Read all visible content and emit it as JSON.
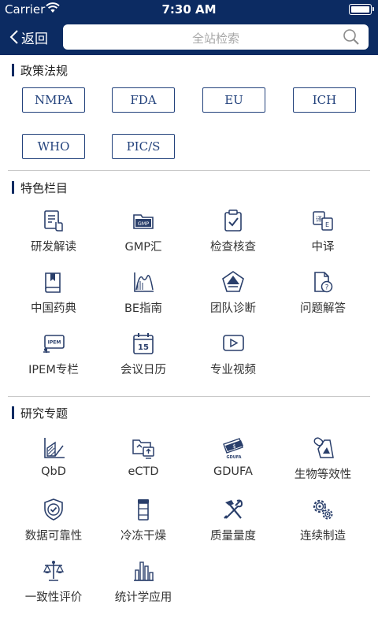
{
  "status": {
    "carrier": "Carrier",
    "time": "7:30 AM"
  },
  "nav": {
    "back_label": "返回",
    "search_placeholder": "全站检索"
  },
  "policy": {
    "title": "政策法规",
    "tags": [
      "NMPA",
      "FDA",
      "EU",
      "ICH",
      "WHO",
      "PIC/S"
    ]
  },
  "featured": {
    "title": "特色栏目",
    "items": [
      {
        "label": "研发解读",
        "icon": "document-hand-icon"
      },
      {
        "label": "GMP汇",
        "icon": "gmp-folder-icon"
      },
      {
        "label": "检查核查",
        "icon": "clipboard-check-icon"
      },
      {
        "label": "中译",
        "icon": "translate-icon"
      },
      {
        "label": "中国药典",
        "icon": "pharmacopoeia-book-icon"
      },
      {
        "label": "BE指南",
        "icon": "curve-chart-icon"
      },
      {
        "label": "团队诊断",
        "icon": "pentagon-team-icon"
      },
      {
        "label": "问题解答",
        "icon": "question-document-icon"
      },
      {
        "label": "IPEM专栏",
        "icon": "ipem-card-icon"
      },
      {
        "label": "会议日历",
        "icon": "calendar-icon",
        "calendar_day": "15"
      },
      {
        "label": "专业视频",
        "icon": "video-play-icon"
      }
    ]
  },
  "research": {
    "title": "研究专题",
    "items": [
      {
        "label": "QbD",
        "icon": "area-chart-icon"
      },
      {
        "label": "eCTD",
        "icon": "folder-upload-icon"
      },
      {
        "label": "GDUFA",
        "icon": "money-icon",
        "badge": "GDUFA"
      },
      {
        "label": "生物等效性",
        "icon": "pill-bottle-icon"
      },
      {
        "label": "数据可靠性",
        "icon": "shield-check-icon"
      },
      {
        "label": "冷冻干燥",
        "icon": "vial-icon"
      },
      {
        "label": "质量量度",
        "icon": "tools-icon"
      },
      {
        "label": "连续制造",
        "icon": "gears-icon"
      },
      {
        "label": "一致性评价",
        "icon": "balance-scale-icon"
      },
      {
        "label": "统计学应用",
        "icon": "bar-chart-icon"
      }
    ]
  },
  "colors": {
    "header": "#0c2b62",
    "accent": "#23427c",
    "divider": "#c9c9c9"
  }
}
